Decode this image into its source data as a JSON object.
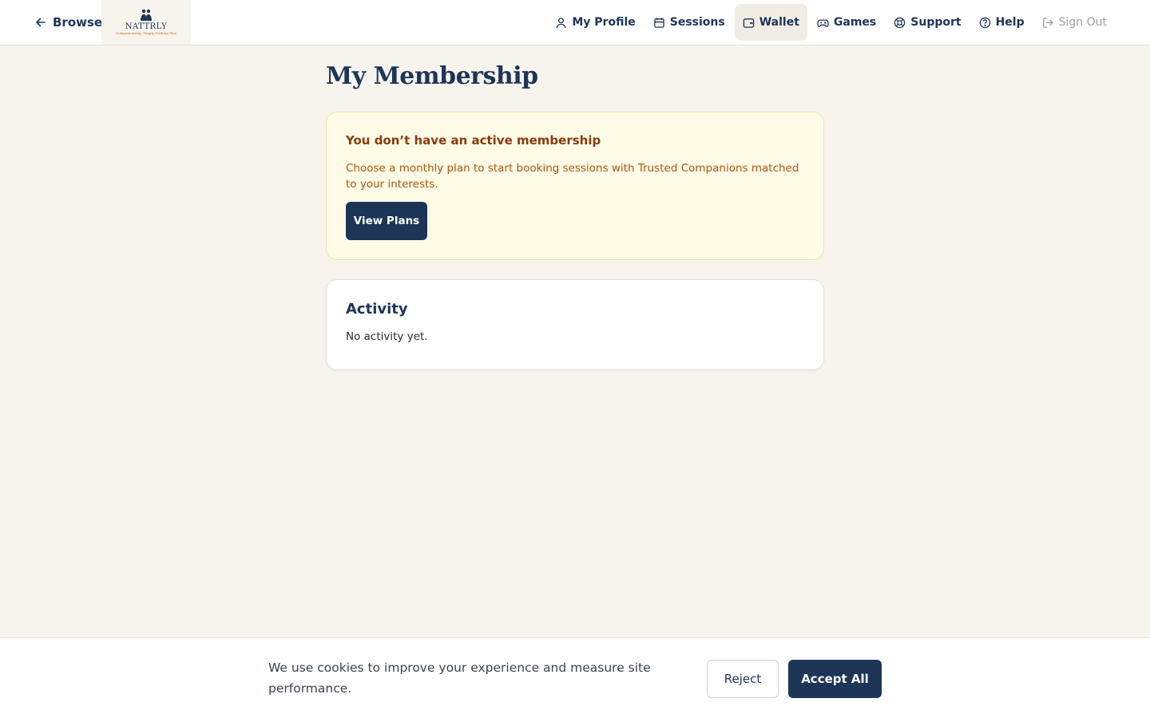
{
  "header": {
    "back_label": "Browse",
    "logo": {
      "wordmark": "NATTRLY",
      "tagline": "Companionship, Simply Nothing Else"
    },
    "nav": [
      {
        "label": "My Profile",
        "icon": "user-icon"
      },
      {
        "label": "Sessions",
        "icon": "calendar-icon"
      },
      {
        "label": "Wallet",
        "icon": "wallet-icon",
        "active": true
      },
      {
        "label": "Games",
        "icon": "gamepad-icon"
      },
      {
        "label": "Support",
        "icon": "lifebuoy-icon"
      },
      {
        "label": "Help",
        "icon": "help-circle-icon"
      },
      {
        "label": "Sign Out",
        "icon": "sign-out-icon",
        "muted": true
      }
    ]
  },
  "main": {
    "title": "My Membership",
    "membership_notice": {
      "title": "You don’t have an active membership",
      "body": "Choose a monthly plan to start booking sessions with Trusted Companions matched to your interests.",
      "button_label": "View Plans"
    },
    "activity": {
      "title": "Activity",
      "empty_text": "No activity yet."
    }
  },
  "cookie_banner": {
    "text": "We use cookies to improve your experience and measure site performance.",
    "reject_label": "Reject",
    "accept_label": "Accept All"
  },
  "colors": {
    "brand_navy": "#1d3557",
    "page_bg": "#f7f4ee",
    "warning_bg": "#fefbe6",
    "warning_title": "#8a3a0c",
    "warning_text": "#b0540f"
  }
}
